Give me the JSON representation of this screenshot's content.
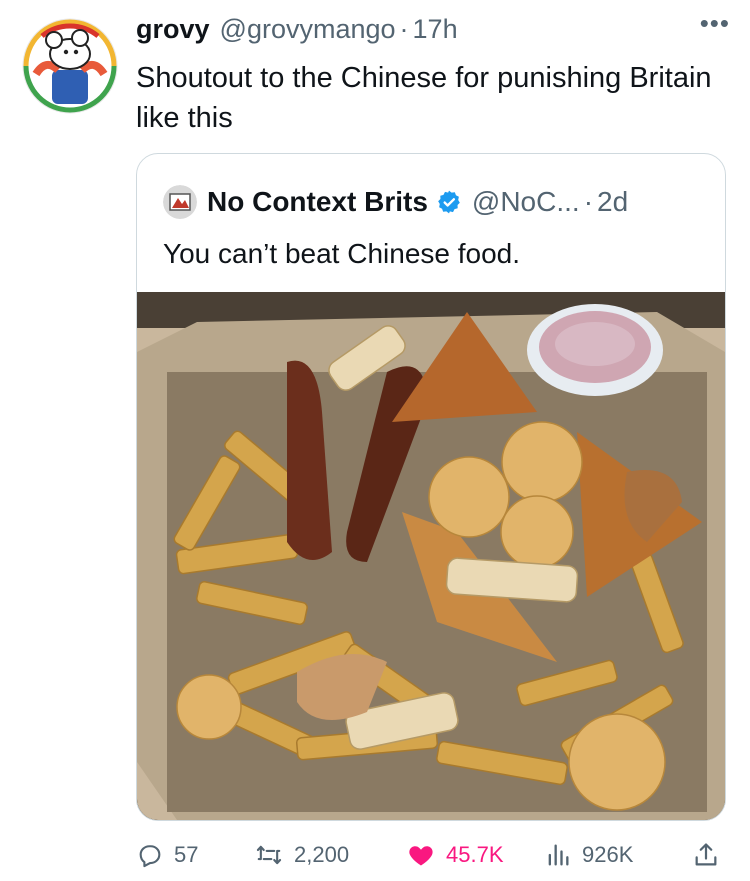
{
  "tweet": {
    "author": {
      "name": "grovy",
      "handle": "@grovymango",
      "time": "17h"
    },
    "text": "Shoutout to the Chinese for punishing Britain like this"
  },
  "quoted": {
    "author": {
      "name": "No Context Brits",
      "handle": "@NoC...",
      "time": "2d"
    },
    "text": "You can’t beat Chinese food.",
    "verified_color": "#1d9bf0"
  },
  "actions": {
    "replies": "57",
    "retweets": "2,200",
    "likes": "45.7K",
    "views": "926K"
  },
  "colors": {
    "like": "#f91880",
    "muted": "#536471",
    "text": "#0f1419"
  }
}
